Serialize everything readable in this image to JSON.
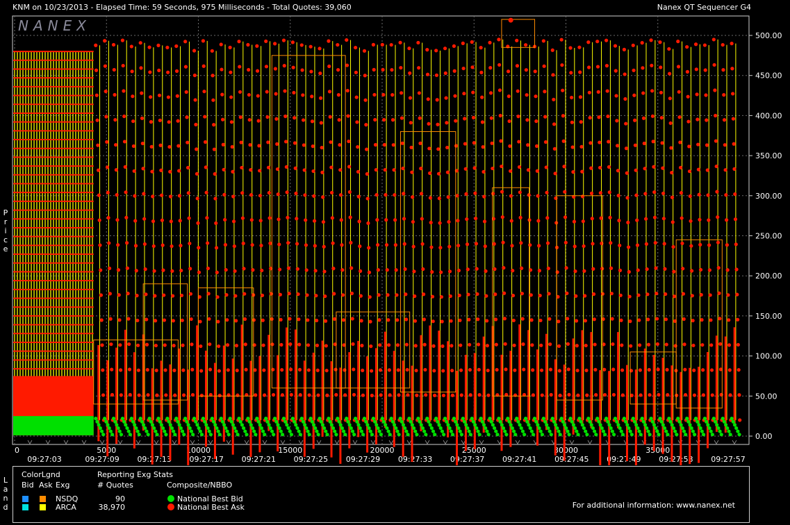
{
  "header": {
    "left": "KNM on 10/23/2013  -  Elapsed Time: 59 Seconds, 975 Milliseconds  -  Total Quotes: 39,060",
    "right": "Nanex QT Sequencer G4"
  },
  "logo": "NANEX",
  "side_labels": {
    "price": "Price",
    "land": "Land"
  },
  "colors": {
    "background": "#000000",
    "grid": "#6b6b6b",
    "frame": "#d0d0d0",
    "bid": "#00e000",
    "ask": "#ff1a00",
    "ask_line": "#ffff00",
    "nsdq_bid": "#1e8fff",
    "nsdq_ask": "#ff8c00",
    "arca_bid": "#00e0e0",
    "arca_ask": "#ffff00",
    "nbbo_box": "#ff8c00"
  },
  "chart_data": {
    "type": "scatter",
    "title": "KNM on 10/23/2013",
    "x_ticks": [
      "0",
      "5000",
      "10000",
      "15000",
      "20000",
      "25000",
      "30000",
      "35000"
    ],
    "x_range": [
      0,
      39060
    ],
    "time_ticks": [
      "09:27:03",
      "09:27:09",
      "09:27:13",
      "09:27:17",
      "09:27:21",
      "09:27:25",
      "09:27:29",
      "09:27:33",
      "09:27:37",
      "09:27:41",
      "09:27:45",
      "09:27:49",
      "09:27:53",
      "09:27:57"
    ],
    "y_ticks": [
      "0.00",
      "50.00",
      "100.00",
      "150.00",
      "200.00",
      "250.00",
      "300.00",
      "350.00",
      "400.00",
      "450.00",
      "500.00"
    ],
    "y_range": [
      0,
      500
    ],
    "grid": true,
    "ylabel": "Price",
    "series": [
      {
        "name": "National Best Bid",
        "approx_range": [
          1,
          25
        ]
      },
      {
        "name": "National Best Ask",
        "approx_range": [
          1,
          519
        ]
      }
    ],
    "ask_cycle_starts": [
      0,
      4300
    ],
    "ask_cycle_count": 72,
    "ask_cycle_max": 495,
    "phase_one_end": 4300,
    "phase_one_ladder_high": 480,
    "phase_one_ladder_low": 75
  },
  "legend": {
    "color_title": "ColorLgnd",
    "col_bid": "Bid",
    "col_ask": "Ask",
    "col_exg": "Exg",
    "stats_title": "Reporting Exg Stats",
    "stats_col": "# Quotes",
    "composite_title": "Composite/NBBO",
    "exchanges": [
      {
        "name": "NSDQ",
        "quotes": "90"
      },
      {
        "name": "ARCA",
        "quotes": "38,970"
      }
    ],
    "nbbo_bid": "National Best Bid",
    "nbbo_ask": "National Best Ask",
    "info": "For additional information: www.nanex.net"
  }
}
